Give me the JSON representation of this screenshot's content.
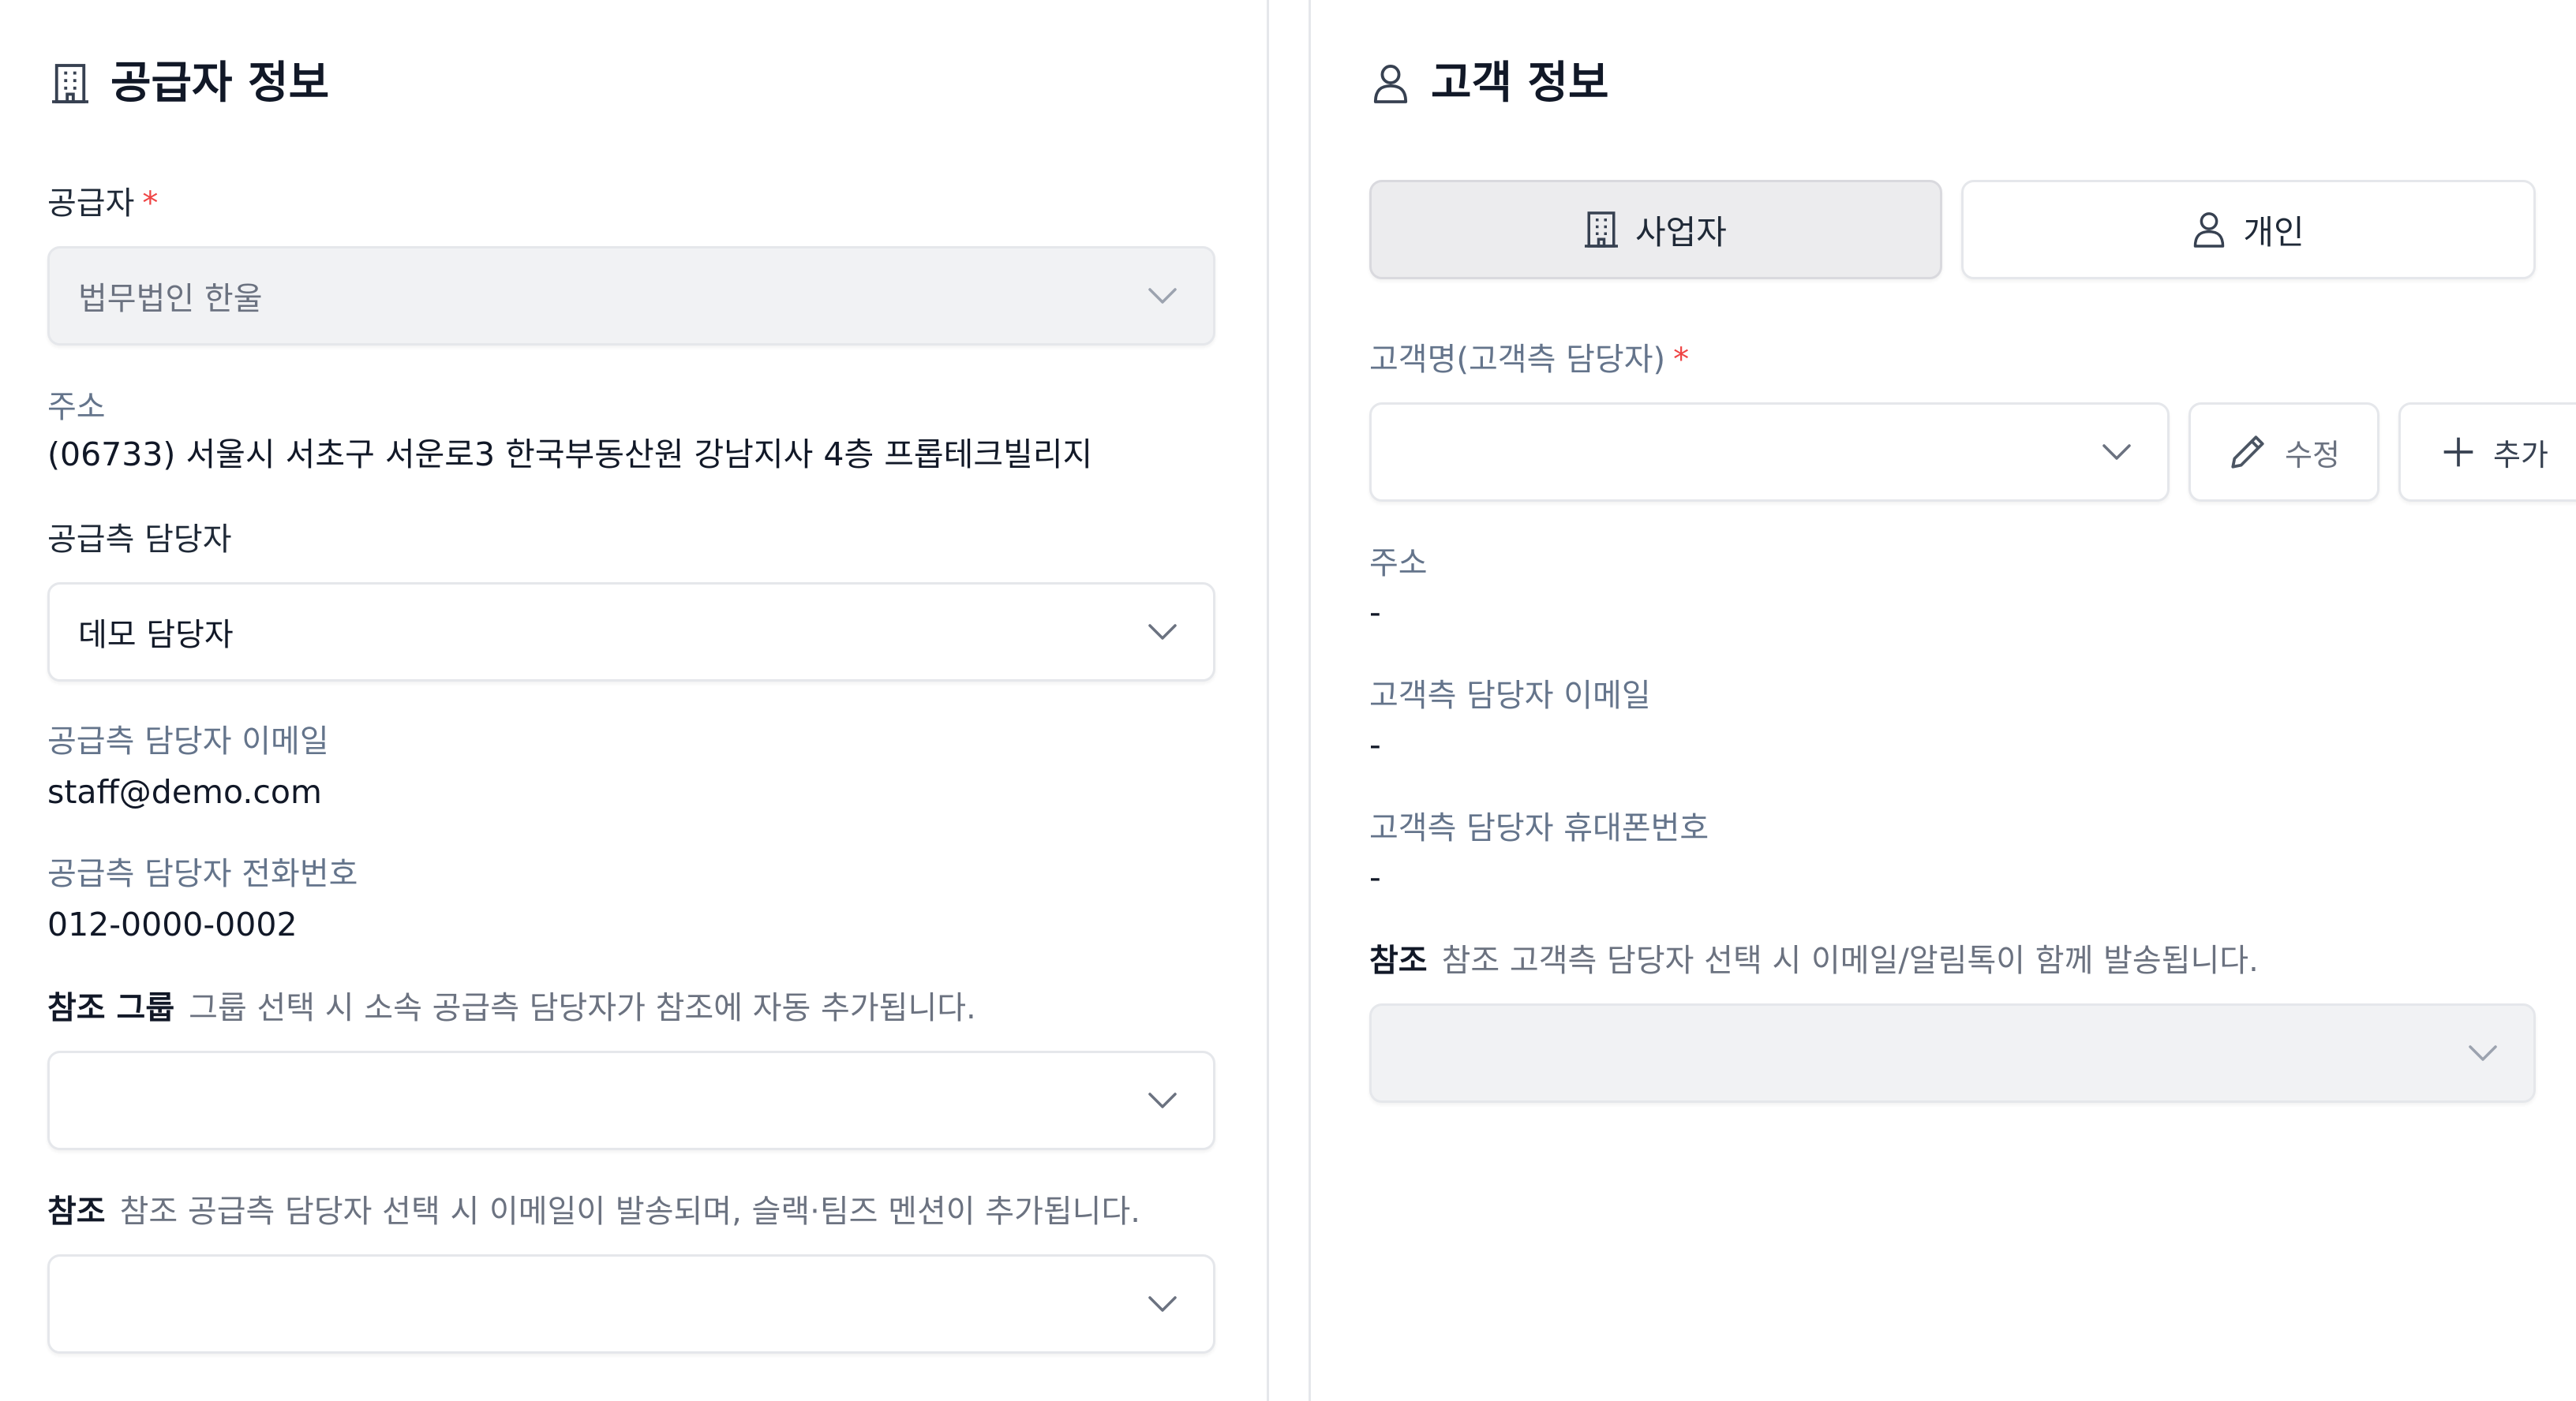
{
  "supplier": {
    "title": "공급자 정보",
    "title_icon": "building-icon",
    "supplier_label": "공급자",
    "required_mark": "*",
    "supplier_value": "법무법인 한울",
    "address_label": "주소",
    "address_value": "(06733) 서울시 서초구 서운로3 한국부동산원 강남지사 4층 프롭테크빌리지",
    "manager_label": "공급측 담당자",
    "manager_value": "데모 담당자",
    "email_label": "공급측 담당자 이메일",
    "email_value": "staff@demo.com",
    "phone_label": "공급측 담당자 전화번호",
    "phone_value": "012-0000-0002",
    "cc_group_label": "참조 그룹",
    "cc_group_hint": "그룹 선택 시 소속 공급측 담당자가 참조에 자동 추가됩니다.",
    "cc_label": "참조",
    "cc_hint": "참조 공급측 담당자 선택 시 이메일이 발송되며, 슬랙·팀즈 멘션이 추가됩니다."
  },
  "customer": {
    "title": "고객 정보",
    "title_icon": "user-icon",
    "type_business": "사업자",
    "type_personal": "개인",
    "selected_type": "사업자",
    "name_label": "고객명(고객측 담당자)",
    "required_mark": "*",
    "name_value": "",
    "edit_button": "수정",
    "add_button": "추가",
    "address_label": "주소",
    "address_value": "-",
    "email_label": "고객측 담당자 이메일",
    "email_value": "-",
    "mobile_label": "고객측 담당자 휴대폰번호",
    "mobile_value": "-",
    "cc_label": "참조",
    "cc_hint": "참조 고객측 담당자 선택 시 이메일/알림톡이 함께 발송됩니다."
  },
  "colors": {
    "required": "#ef4444",
    "muted_label": "#64748b",
    "border": "#e5e7eb",
    "disabled_bg": "#f1f2f4",
    "active_toggle_bg": "#ececee"
  }
}
